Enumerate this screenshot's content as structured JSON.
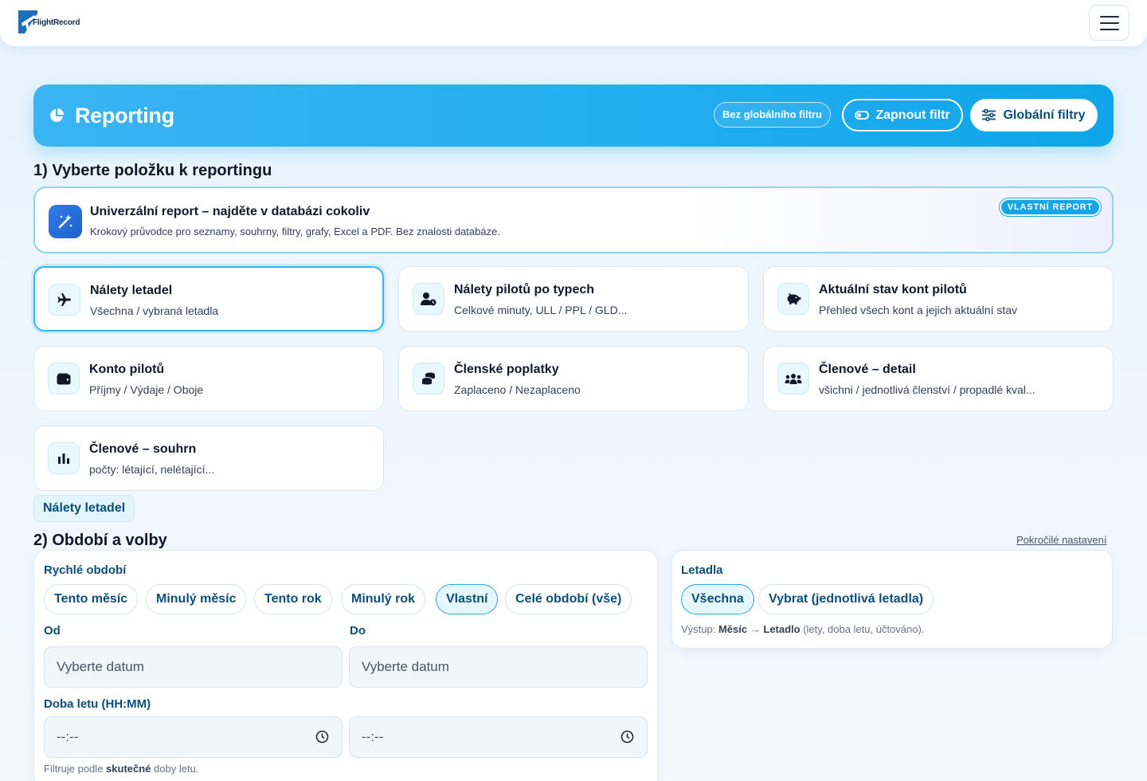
{
  "app": {
    "logo_text": "FlightRecord"
  },
  "hero": {
    "title": "Reporting",
    "no_filter_label": "Bez globálního filtru",
    "toggle_label": "Zapnout filtr",
    "global_filters_label": "Globální filtry"
  },
  "step1": {
    "title": "1) Vyberte položku k reportingu",
    "universal": {
      "title": "Univerzální report – najděte v databázi cokoliv",
      "subtitle": "Krokový průvodce pro seznamy, souhrny, filtry, grafy, Excel a PDF. Bez znalosti databáze.",
      "badge": "VLASTNÍ REPORT",
      "icon": "magic-wand-icon"
    },
    "cards": [
      {
        "title": "Nálety letadel",
        "subtitle": "Všechna / vybraná letadla",
        "icon": "airplane-icon",
        "selected": true
      },
      {
        "title": "Nálety pilotů po typech",
        "subtitle": "Celkové minuty, ULL / PPL / GLD...",
        "icon": "user-clock-icon"
      },
      {
        "title": "Aktuální stav kont pilotů",
        "subtitle": "Přehled všech kont a jejich aktuální stav",
        "icon": "piggy-bank-icon"
      },
      {
        "title": "Konto pilotů",
        "subtitle": "Příjmy / Výdaje / Oboje",
        "icon": "wallet-icon"
      },
      {
        "title": "Členské poplatky",
        "subtitle": "Zaplaceno / Nezaplaceno",
        "icon": "coins-icon"
      },
      {
        "title": "Členové – detail",
        "subtitle": "všichni / jednotlivá členství / propadlé kval...",
        "icon": "people-group-icon"
      },
      {
        "title": "Členové – souhrn",
        "subtitle": "počty: létající, nelétající...",
        "icon": "bar-chart-icon"
      }
    ],
    "selected_label": "Nálety letadel"
  },
  "step2": {
    "title": "2) Období a volby",
    "advanced_link": "Pokročilé nastavení",
    "quick_period_label": "Rychlé období",
    "quick_periods": [
      "Tento měsíc",
      "Minulý měsíc",
      "Tento rok",
      "Minulý rok",
      "Vlastní",
      "Celé období (vše)"
    ],
    "active_period": "Vlastní",
    "from_label": "Od",
    "to_label": "Do",
    "from_placeholder": "Vyberte datum",
    "to_placeholder": "Vyberte datum",
    "duration_label": "Doba letu (HH:MM)",
    "duration_from_value": "--:--",
    "duration_to_value": "--:--",
    "duration_hint_prefix": "Filtruje podle ",
    "duration_hint_bold": "skutečné",
    "duration_hint_suffix": " doby letu.",
    "aircraft": {
      "label": "Letadla",
      "options": [
        "Všechna",
        "Vybrat (jednotlivá letadla)"
      ],
      "active": "Všechna",
      "output_prefix": "Výstup: ",
      "output_month": "Měsíc",
      "output_arrow": " → ",
      "output_aircraft": "Letadlo",
      "output_suffix": " (lety, doba letu, účtováno)."
    }
  },
  "colors": {
    "accent": "#0ea5e9",
    "primary_text": "#0b4f79",
    "badge": "#16a5e6"
  }
}
